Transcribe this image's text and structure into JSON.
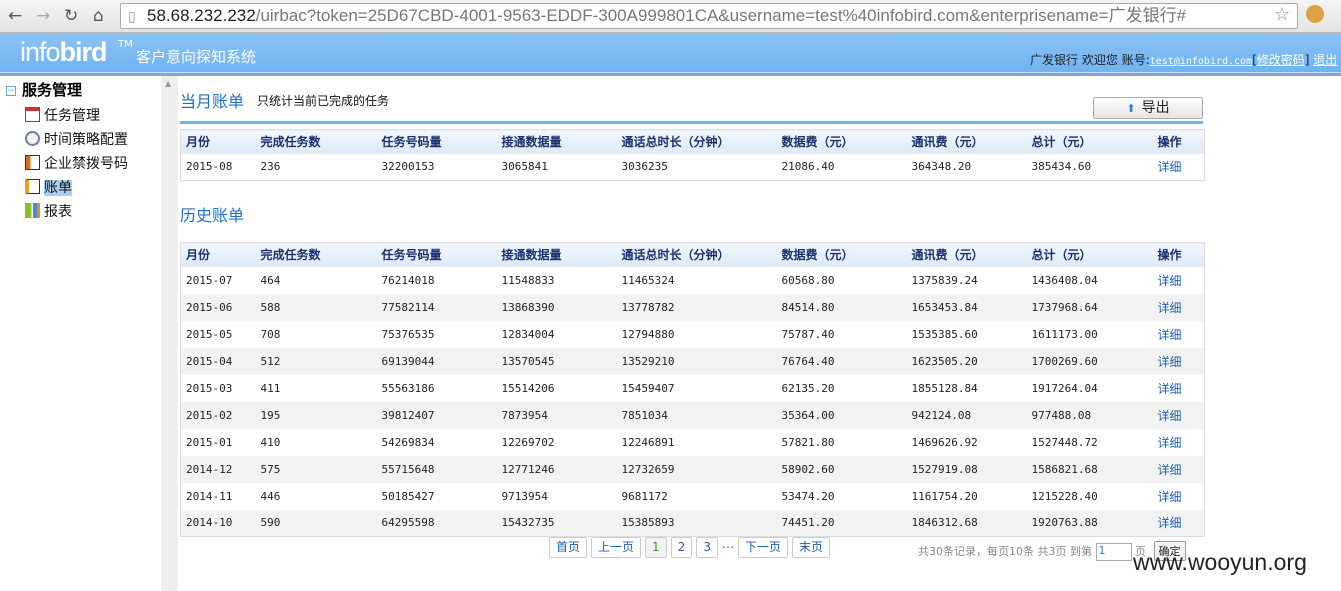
{
  "browser": {
    "url_host": "58.68.232.232",
    "url_rest": "/uirbac?token=25D67CBD-4001-9563-EDDF-300A999801CA&username=test%40infobird.com&enterprisename=广发银行#"
  },
  "header": {
    "logo_light": "info",
    "logo_bold": "bird",
    "tm": "TM",
    "system_title": "客户意向探知系统",
    "company": "广发银行",
    "welcome": "欢迎您",
    "account_label": "账号:",
    "account": "test@infobird.com",
    "change_password": "修改密码",
    "logout": "退出"
  },
  "sidebar": {
    "root": "服务管理",
    "items": [
      {
        "label": "任务管理",
        "icon": "calendar-icon"
      },
      {
        "label": "时间策略配置",
        "icon": "clock-icon"
      },
      {
        "label": "企业禁拨号码",
        "icon": "book-icon"
      },
      {
        "label": "账单",
        "icon": "document-icon",
        "selected": true
      },
      {
        "label": "报表",
        "icon": "bar-chart-icon"
      }
    ]
  },
  "current": {
    "title": "当月账单",
    "note": "只统计当前已完成的任务",
    "export_label": "导出"
  },
  "columns": [
    "月份",
    "完成任务数",
    "任务号码量",
    "接通数据量",
    "通话总时长（分钟）",
    "数据费（元）",
    "通讯费（元）",
    "总计（元）",
    "操作"
  ],
  "current_rows": [
    [
      "2015-08",
      "236",
      "32200153",
      "3065841",
      "3036235",
      "21086.40",
      "364348.20",
      "385434.60",
      "详细"
    ]
  ],
  "history": {
    "title": "历史账单",
    "rows": [
      [
        "2015-07",
        "464",
        "76214018",
        "11548833",
        "11465324",
        "60568.80",
        "1375839.24",
        "1436408.04",
        "详细"
      ],
      [
        "2015-06",
        "588",
        "77582114",
        "13868390",
        "13778782",
        "84514.80",
        "1653453.84",
        "1737968.64",
        "详细"
      ],
      [
        "2015-05",
        "708",
        "75376535",
        "12834004",
        "12794880",
        "75787.40",
        "1535385.60",
        "1611173.00",
        "详细"
      ],
      [
        "2015-04",
        "512",
        "69139044",
        "13570545",
        "13529210",
        "76764.40",
        "1623505.20",
        "1700269.60",
        "详细"
      ],
      [
        "2015-03",
        "411",
        "55563186",
        "15514206",
        "15459407",
        "62135.20",
        "1855128.84",
        "1917264.04",
        "详细"
      ],
      [
        "2015-02",
        "195",
        "39812407",
        "7873954",
        "7851034",
        "35364.00",
        "942124.08",
        "977488.08",
        "详细"
      ],
      [
        "2015-01",
        "410",
        "54269834",
        "12269702",
        "12246891",
        "57821.80",
        "1469626.92",
        "1527448.72",
        "详细"
      ],
      [
        "2014-12",
        "575",
        "55715648",
        "12771246",
        "12732659",
        "58902.60",
        "1527919.08",
        "1586821.68",
        "详细"
      ],
      [
        "2014-11",
        "446",
        "50185427",
        "9713954",
        "9681172",
        "53474.20",
        "1161754.20",
        "1215228.40",
        "详细"
      ],
      [
        "2014-10",
        "590",
        "64295598",
        "15432735",
        "15385893",
        "74451.20",
        "1846312.68",
        "1920763.88",
        "详细"
      ]
    ]
  },
  "pager": {
    "first": "首页",
    "prev": "上一页",
    "pages": [
      "1",
      "2",
      "3"
    ],
    "current": "1",
    "ellipsis": "…",
    "next": "下一页",
    "last": "末页",
    "summary": "共30条记录，每页10条 共3页 到第",
    "goto_value": "1",
    "page_unit": "页",
    "confirm": "确定"
  },
  "watermark": "www.wooyun.org"
}
